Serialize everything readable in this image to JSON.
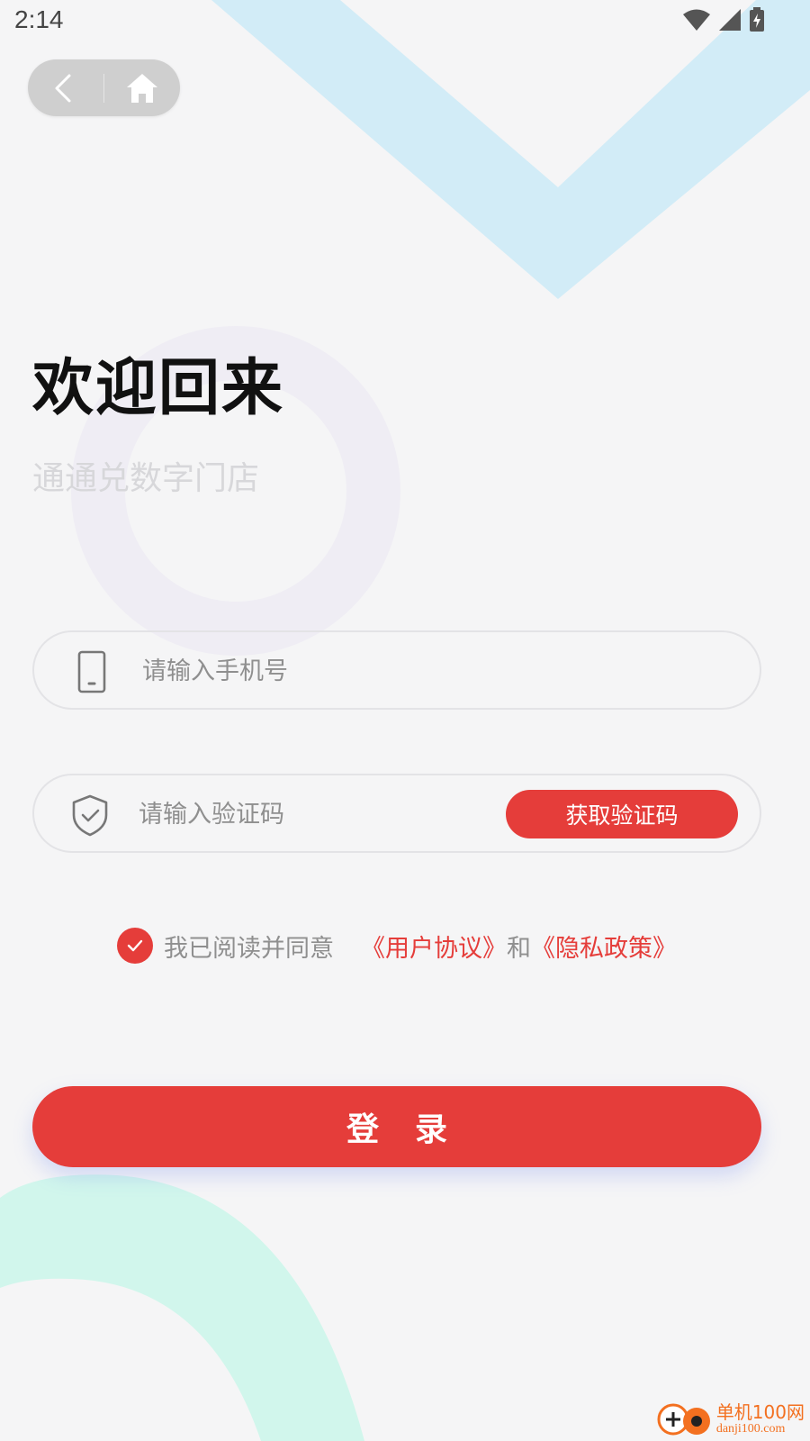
{
  "status_bar": {
    "time": "2:14"
  },
  "nav": {
    "back_icon": "chevron-left-icon",
    "home_icon": "home-icon"
  },
  "welcome": {
    "title": "欢迎回来",
    "subtitle": "通通兑数字门店"
  },
  "phone": {
    "placeholder": "请输入手机号",
    "value": "",
    "icon": "phone-icon"
  },
  "code": {
    "placeholder": "请输入验证码",
    "value": "",
    "icon": "shield-check-icon",
    "get_code_label": "获取验证码"
  },
  "agreement": {
    "checked": true,
    "prefix": "我已阅读并同意",
    "user_agreement": "《用户协议》",
    "conjunction": "和",
    "privacy_policy": "《隐私政策》"
  },
  "login": {
    "label": "登录"
  },
  "watermark": {
    "name": "单机100网",
    "url": "danji100.com"
  },
  "colors": {
    "accent": "#e53d3a",
    "background": "#f5f5f6",
    "decor_blue": "#d2ecf7",
    "decor_mint": "#d1f6ec",
    "decor_lavender": "#f0eef5"
  }
}
